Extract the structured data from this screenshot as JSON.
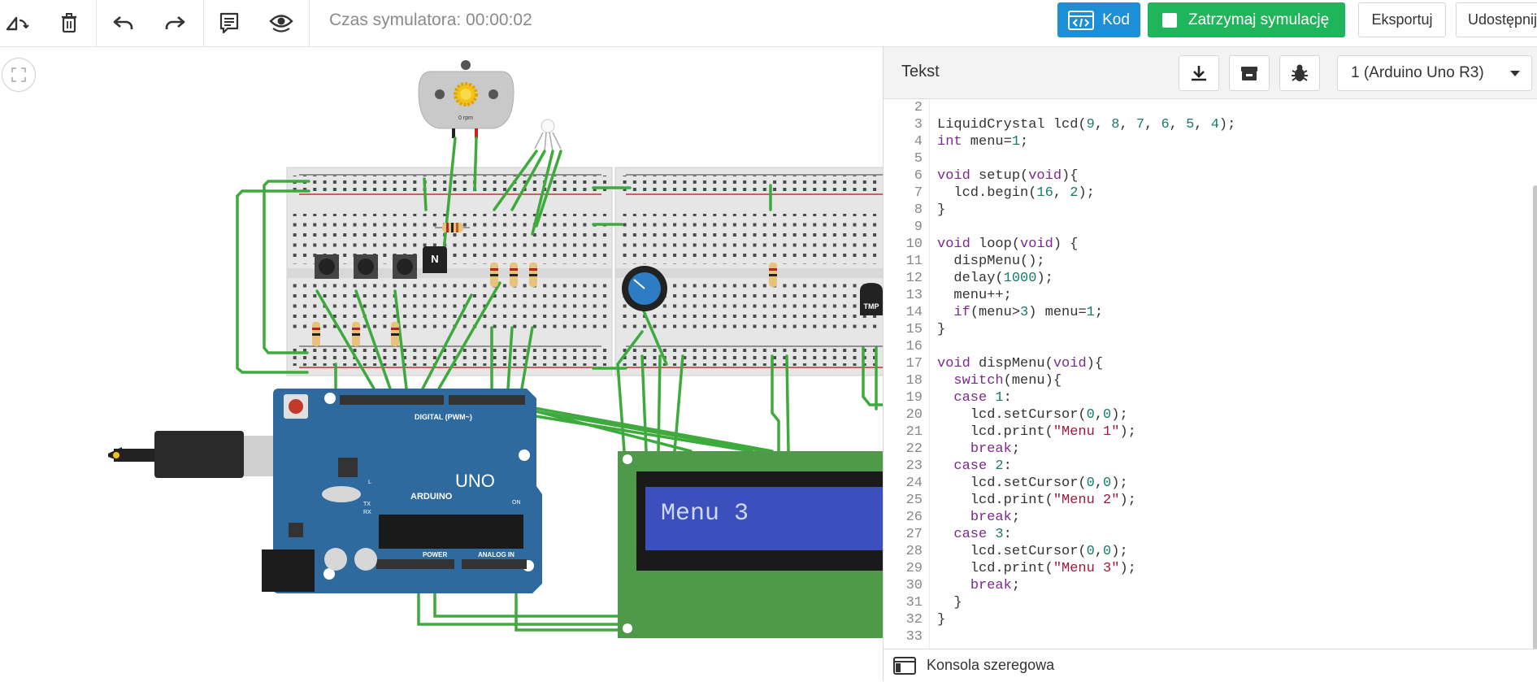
{
  "toolbar": {
    "icons": [
      "rotate-icon",
      "trash-icon",
      "undo-icon",
      "redo-icon",
      "notes-icon",
      "visibility-icon"
    ],
    "sim_time": "Czas symulatora: 00:00:02",
    "kod_label": "Kod",
    "stop_label": "Zatrzymaj symulację",
    "export_label": "Eksportuj",
    "share_label": "Udostępnij"
  },
  "circuit": {
    "lcd_text": "Menu 3",
    "motor_label": "0 rpm",
    "transistor_label": "N",
    "tmp_label": "TMP",
    "arduino_logo": "ARDUINO",
    "arduino_uno": "UNO",
    "digital_label": "DIGITAL (PWM~)",
    "power_label": "POWER",
    "analog_label": "ANALOG IN",
    "on_label": "ON",
    "tx_label": "TX",
    "rx_label": "RX",
    "l_label": "L"
  },
  "panel": {
    "title": "Tekst",
    "board_select": "1 (Arduino Uno R3)",
    "icons": [
      "download-icon",
      "library-icon",
      "debug-icon"
    ],
    "console_label": "Konsola szeregowa"
  },
  "code": [
    {
      "n": "2",
      "t": ""
    },
    {
      "n": "3",
      "t": "LiquidCrystal lcd(9, 8, 7, 6, 5, 4);"
    },
    {
      "n": "4",
      "t": "int menu=1;"
    },
    {
      "n": "5",
      "t": ""
    },
    {
      "n": "6",
      "t": "void setup(void){"
    },
    {
      "n": "7",
      "t": "  lcd.begin(16, 2);"
    },
    {
      "n": "8",
      "t": "}"
    },
    {
      "n": "9",
      "t": ""
    },
    {
      "n": "10",
      "t": "void loop(void) {"
    },
    {
      "n": "11",
      "t": "  dispMenu();"
    },
    {
      "n": "12",
      "t": "  delay(1000);"
    },
    {
      "n": "13",
      "t": "  menu++;"
    },
    {
      "n": "14",
      "t": "  if(menu>3) menu=1;"
    },
    {
      "n": "15",
      "t": "}"
    },
    {
      "n": "16",
      "t": ""
    },
    {
      "n": "17",
      "t": "void dispMenu(void){"
    },
    {
      "n": "18",
      "t": "  switch(menu){"
    },
    {
      "n": "19",
      "t": "  case 1:"
    },
    {
      "n": "20",
      "t": "    lcd.setCursor(0,0);"
    },
    {
      "n": "21",
      "t": "    lcd.print(\"Menu 1\");"
    },
    {
      "n": "22",
      "t": "    break;"
    },
    {
      "n": "23",
      "t": "  case 2:"
    },
    {
      "n": "24",
      "t": "    lcd.setCursor(0,0);"
    },
    {
      "n": "25",
      "t": "    lcd.print(\"Menu 2\");"
    },
    {
      "n": "26",
      "t": "    break;"
    },
    {
      "n": "27",
      "t": "  case 3:"
    },
    {
      "n": "28",
      "t": "    lcd.setCursor(0,0);"
    },
    {
      "n": "29",
      "t": "    lcd.print(\"Menu 3\");"
    },
    {
      "n": "30",
      "t": "    break;"
    },
    {
      "n": "31",
      "t": "  }"
    },
    {
      "n": "32",
      "t": "}"
    },
    {
      "n": "33",
      "t": ""
    }
  ],
  "colors": {
    "kod_blue": "#1d8fd6",
    "stop_green": "#1fb55a",
    "board_blue": "#2f6a9e",
    "lcd_green": "#4e9a4a",
    "lcd_screen": "#3b4fbd",
    "wire_green": "#3eaa3e"
  }
}
